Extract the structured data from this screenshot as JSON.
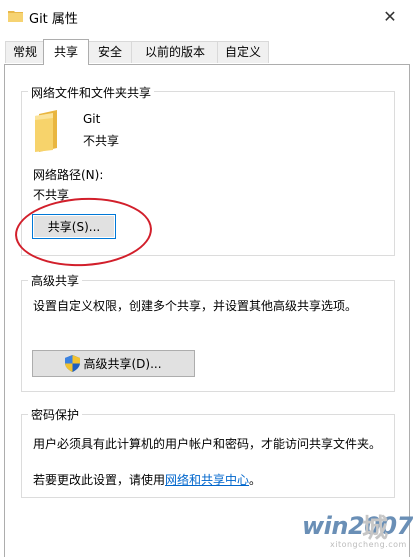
{
  "window": {
    "title": "Git 属性",
    "close_glyph": "✕"
  },
  "tabs": [
    {
      "label": "常规"
    },
    {
      "label": "共享",
      "active": true
    },
    {
      "label": "安全"
    },
    {
      "label": "以前的版本"
    },
    {
      "label": "自定义"
    }
  ],
  "network_share": {
    "group_title": "网络文件和文件夹共享",
    "folder_name": "Git",
    "folder_status": "不共享",
    "path_label": "网络路径(N):",
    "path_value": "不共享",
    "share_button": "共享(S)..."
  },
  "advanced_share": {
    "group_title": "高级共享",
    "description": "设置自定义权限，创建多个共享，并设置其他高级共享选项。",
    "button": "高级共享(D)..."
  },
  "password": {
    "group_title": "密码保护",
    "description": "用户必须具有此计算机的用户帐户和密码，才能访问共享文件夹。",
    "change_prefix": "若要更改此设置，请使用",
    "link_text": "网络和共享中心",
    "change_suffix": "。"
  },
  "watermark": {
    "text": "win2007",
    "cn": "城",
    "sub": "xitongcheng.com"
  },
  "colors": {
    "accent": "#0078d7",
    "annotation": "#d21f2b",
    "link": "#0066cc"
  }
}
